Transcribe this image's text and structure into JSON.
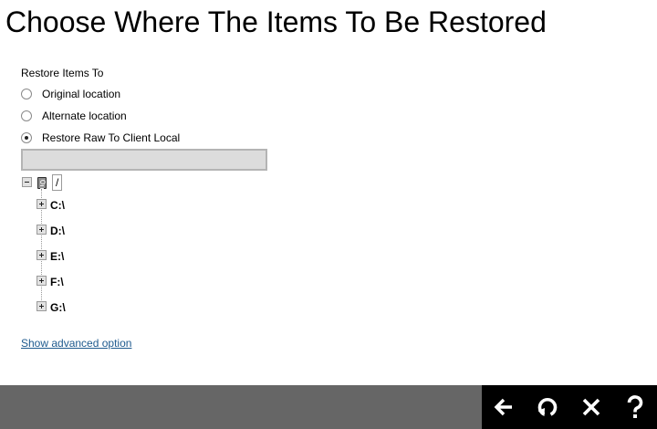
{
  "page": {
    "title": "Choose Where The Items To Be Restored"
  },
  "restore_options": {
    "label": "Restore Items To",
    "options": [
      {
        "label": "Original location",
        "selected": false
      },
      {
        "label": "Alternate location",
        "selected": false
      },
      {
        "label": "Restore Raw To Client Local",
        "selected": true
      }
    ]
  },
  "path_input": {
    "value": "",
    "placeholder": ""
  },
  "tree": {
    "root": {
      "label": "/",
      "expanded": true,
      "icon": "server-icon"
    },
    "children": [
      {
        "label": "C:\\",
        "expanded": false
      },
      {
        "label": "D:\\",
        "expanded": false
      },
      {
        "label": "E:\\",
        "expanded": false
      },
      {
        "label": "F:\\",
        "expanded": false
      },
      {
        "label": "G:\\",
        "expanded": false
      }
    ]
  },
  "advanced_link": {
    "label": "Show advanced option"
  },
  "footer": {
    "buttons": [
      {
        "name": "back",
        "icon": "arrow-left-icon"
      },
      {
        "name": "restore",
        "icon": "restore-icon"
      },
      {
        "name": "close",
        "icon": "close-icon"
      },
      {
        "name": "help",
        "icon": "question-icon"
      }
    ]
  },
  "colors": {
    "link": "#1e5a8e",
    "footer_bar": "#666666",
    "footer_actions": "#000000",
    "input_background": "#dcdcdc"
  }
}
